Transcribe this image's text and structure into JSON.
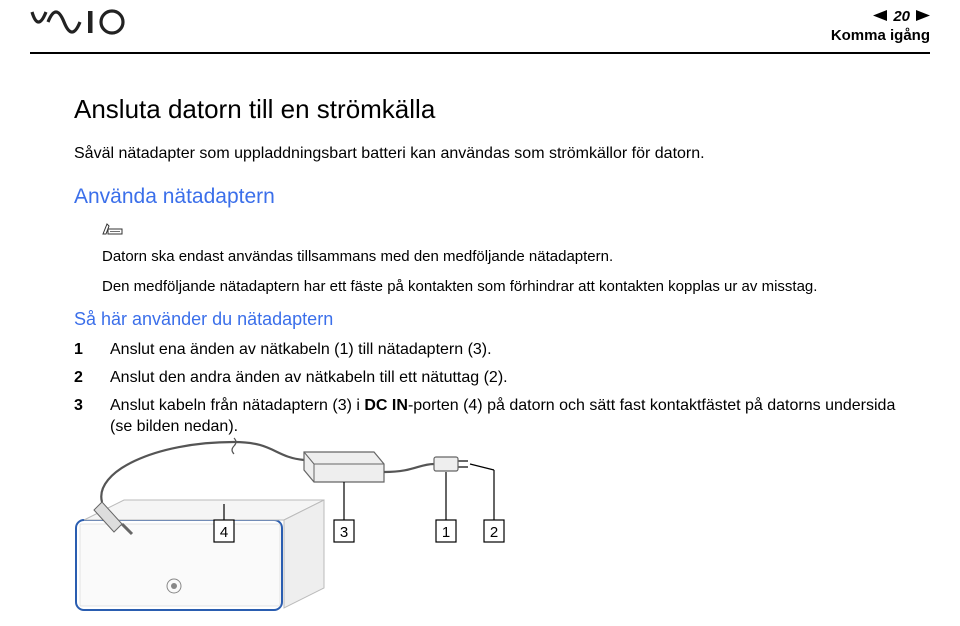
{
  "header": {
    "logo_text": "VAIO",
    "page_number": "20",
    "section": "Komma igång"
  },
  "content": {
    "h1": "Ansluta datorn till en strömkälla",
    "intro": "Såväl nätadapter som uppladdningsbart batteri kan användas som strömkällor för datorn.",
    "h2": "Använda nätadaptern",
    "note_line1": "Datorn ska endast användas tillsammans med den medföljande nätadaptern.",
    "note_line2": "Den medföljande nätadaptern har ett fäste på kontakten som förhindrar att kontakten kopplas ur av misstag.",
    "h3": "Så här använder du nätadaptern",
    "steps": [
      {
        "num": "1",
        "text": "Anslut ena änden av nätkabeln (1) till nätadaptern (3)."
      },
      {
        "num": "2",
        "text": "Anslut den andra änden av nätkabeln till ett nätuttag (2)."
      },
      {
        "num": "3",
        "text_before": "Anslut kabeln från nätadaptern (3) i ",
        "bold": "DC IN",
        "text_after": "-porten (4) på datorn och sätt fast kontaktfästet på datorns undersida (se bilden nedan)."
      }
    ]
  },
  "figure": {
    "labels": [
      "1",
      "2",
      "3",
      "4"
    ]
  }
}
